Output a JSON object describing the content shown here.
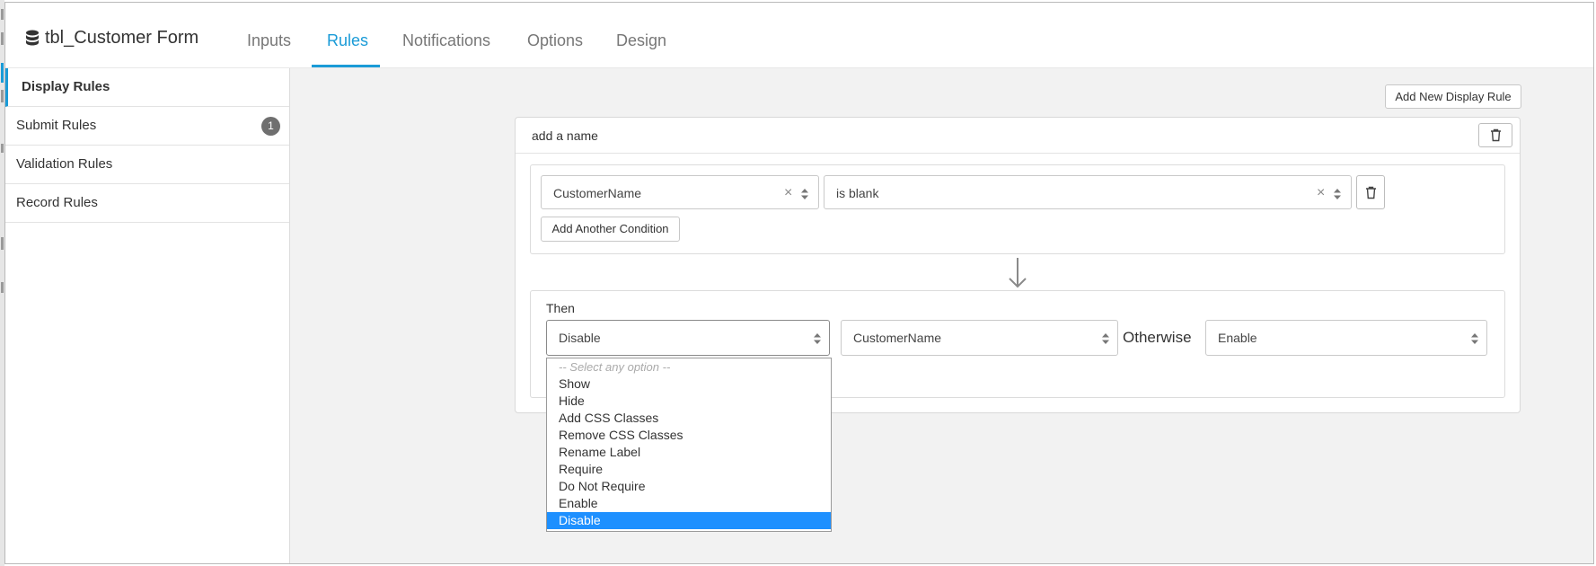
{
  "header": {
    "title": "tbl_Customer Form",
    "title_icon": "database-icon",
    "tabs": [
      {
        "label": "Inputs",
        "active": false
      },
      {
        "label": "Rules",
        "active": true
      },
      {
        "label": "Notifications",
        "active": false
      },
      {
        "label": "Options",
        "active": false
      },
      {
        "label": "Design",
        "active": false
      }
    ]
  },
  "sidebar": {
    "items": [
      {
        "label": "Display Rules",
        "active": true
      },
      {
        "label": "Submit Rules",
        "badge": "1"
      },
      {
        "label": "Validation Rules"
      },
      {
        "label": "Record Rules"
      }
    ]
  },
  "main": {
    "add_rule_label": "Add New Display Rule",
    "rule": {
      "name_placeholder": "add a name",
      "condition": {
        "field": "CustomerName",
        "operator": "is blank",
        "add_condition_label": "Add Another Condition"
      },
      "then_label": "Then",
      "action": "Disable",
      "target_field": "CustomerName",
      "otherwise_label": "Otherwise",
      "otherwise_action": "Enable"
    },
    "dropdown": {
      "placeholder": "-- Select any option --",
      "options": [
        "Show",
        "Hide",
        "Add CSS Classes",
        "Remove CSS Classes",
        "Rename Label",
        "Require",
        "Do Not Require",
        "Enable",
        "Disable"
      ],
      "selected": "Disable"
    }
  },
  "colors": {
    "accent": "#1a9bd7",
    "selected_option": "#1e90ff",
    "badge": "#6f6f6f"
  }
}
